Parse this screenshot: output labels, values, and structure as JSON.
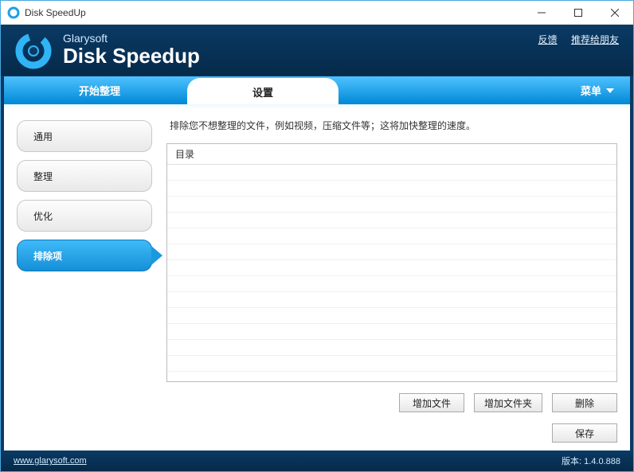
{
  "titlebar": {
    "title": "Disk SpeedUp"
  },
  "header": {
    "company": "Glarysoft",
    "product": "Disk Speedup",
    "links": {
      "feedback": "反馈",
      "recommend": "推荐给朋友"
    }
  },
  "tabs": {
    "start": "开始整理",
    "settings": "设置",
    "menu": "菜单"
  },
  "sidenav": {
    "general": "通用",
    "defrag": "整理",
    "optimize": "优化",
    "exclusions": "排除项"
  },
  "main": {
    "description": "排除您不想整理的文件，例如视频，压缩文件等；这将加快整理的速度。",
    "list_header": "目录",
    "buttons": {
      "add_file": "增加文件",
      "add_folder": "增加文件夹",
      "delete": "删除",
      "save": "保存"
    }
  },
  "footer": {
    "url": "www.glarysoft.com",
    "version_label": "版本: 1.4.0.888"
  }
}
